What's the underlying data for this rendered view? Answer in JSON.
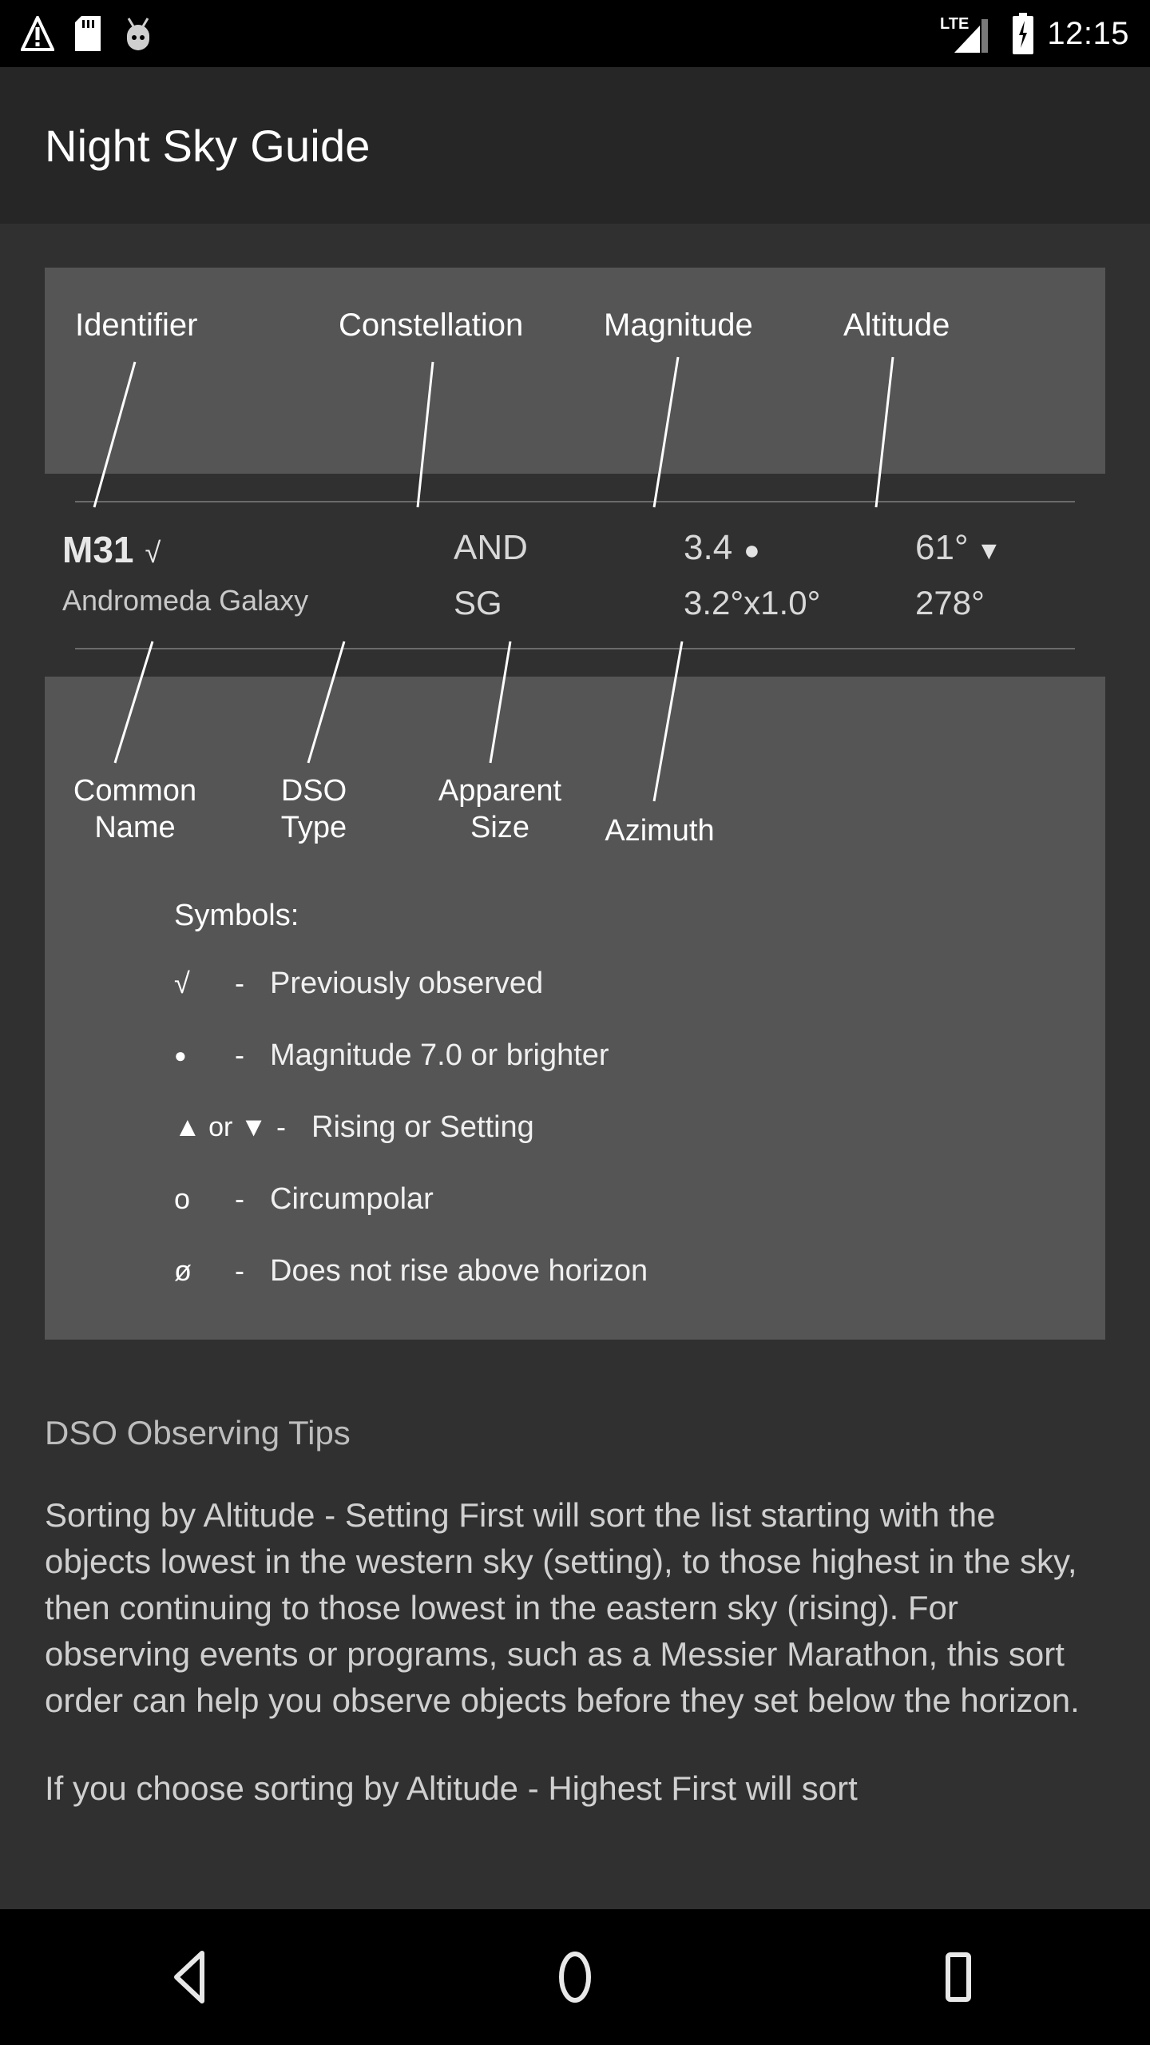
{
  "status_bar": {
    "icons": [
      "warning-triangle-icon",
      "sd-card-icon",
      "android-head-icon"
    ],
    "network_label": "LTE",
    "clock": "12:15"
  },
  "app_bar": {
    "title": "Night Sky Guide"
  },
  "diagram": {
    "top_labels": [
      {
        "name": "identifier",
        "text": "Identifier"
      },
      {
        "name": "constellation",
        "text": "Constellation"
      },
      {
        "name": "magnitude",
        "text": "Magnitude"
      },
      {
        "name": "altitude",
        "text": "Altitude"
      }
    ],
    "bottom_labels": [
      {
        "name": "common-name",
        "text": "Common\nName"
      },
      {
        "name": "dso-type",
        "text": "DSO\nType"
      },
      {
        "name": "apparent-size",
        "text": "Apparent\nSize"
      },
      {
        "name": "azimuth",
        "text": "Azimuth"
      }
    ],
    "sample_row": {
      "identifier": "M31",
      "identifier_symbol": "√",
      "common_name": "Andromeda Galaxy",
      "constellation": "AND",
      "dso_type": "SG",
      "magnitude": "3.4",
      "magnitude_symbol": "●",
      "apparent_size": "3.2°x1.0°",
      "altitude": "61°",
      "altitude_symbol": "▼",
      "azimuth": "278°"
    },
    "symbols": {
      "title": "Symbols:",
      "items": [
        {
          "glyph": "√",
          "dash": "-",
          "text": "Previously observed"
        },
        {
          "glyph": "●",
          "dash": "-",
          "text": "Magnitude 7.0 or brighter"
        },
        {
          "glyph": "▲ or ▼",
          "dash": "-",
          "text": "Rising or Setting"
        },
        {
          "glyph": "o",
          "dash": "-",
          "text": "Circumpolar"
        },
        {
          "glyph": "ø",
          "dash": "-",
          "text": "Does not rise above horizon"
        }
      ]
    }
  },
  "tips": {
    "heading": "DSO Observing Tips",
    "paragraph1": "Sorting by Altitude - Setting First will sort the list starting with the objects lowest in the western sky (setting), to those highest in the sky, then continuing to those lowest in the eastern sky (rising). For observing events or programs, such as a Messier Marathon, this sort order can help you observe objects before they set below the horizon.",
    "paragraph2": "If you choose sorting by Altitude - Highest First will sort"
  },
  "nav_bar": {
    "back": "back-button",
    "home": "home-button",
    "recents": "recents-button"
  },
  "colors": {
    "app_bar": "#262626",
    "content_bg": "#303030",
    "panel_bg": "#555555",
    "text_primary": "#ffffff",
    "text_secondary": "#d0d0d0"
  }
}
